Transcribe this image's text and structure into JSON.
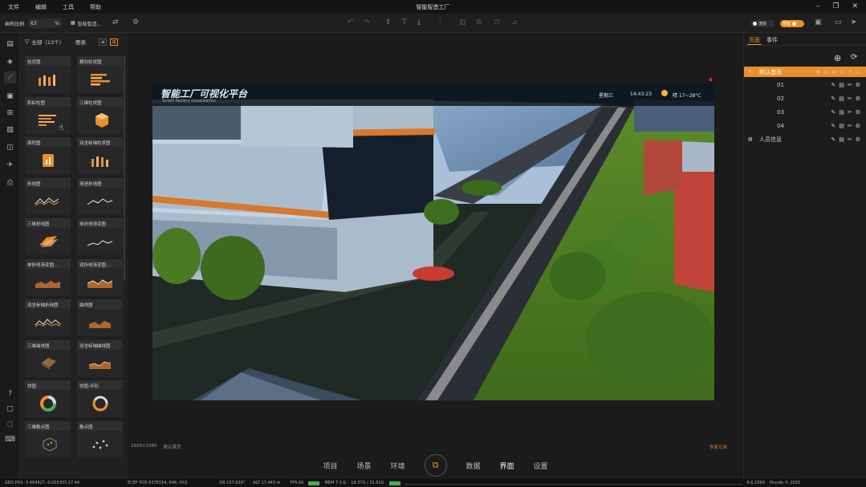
{
  "menu": {
    "items": [
      "文件",
      "编辑",
      "工具",
      "帮助"
    ],
    "title": "智能智造工厂"
  },
  "toolbar": {
    "label": "画布比例",
    "zoom_value": "63",
    "zoom_unit": "%",
    "smart_label": "智能智造...",
    "toggle_left": "渲染",
    "toggle_right": "预览"
  },
  "sidebar_icons": [
    "page-icon",
    "layer-icon",
    "chart-icon",
    "media-icon",
    "table-icon",
    "image-icon",
    "data-icon",
    "plane-icon",
    "printer-icon",
    "help-icon",
    "info-icon",
    "chat-icon",
    "keyboard-icon"
  ],
  "gallery": {
    "filter_label": "全部（13个）",
    "category_label": "图表",
    "cards": [
      {
        "label": "柱状图",
        "thumb": "bars"
      },
      {
        "label": "横向柱状图",
        "thumb": "hbars"
      },
      {
        "label": "彩虹柱图",
        "thumb": "hbars2"
      },
      {
        "label": "三维柱状图",
        "thumb": "cube"
      },
      {
        "label": "面积图",
        "thumb": "square"
      },
      {
        "label": "双坐标轴柱状图",
        "thumb": "bars2"
      },
      {
        "label": "折线图",
        "thumb": "line"
      },
      {
        "label": "渐进折线图",
        "thumb": "line2"
      },
      {
        "label": "三维折线图",
        "thumb": "ribbon"
      },
      {
        "label": "单折线渐变图",
        "thumb": "line3"
      },
      {
        "label": "单折线渐变图...",
        "thumb": "area"
      },
      {
        "label": "双折线渐变图...",
        "thumb": "area2"
      },
      {
        "label": "双坐标轴折线图",
        "thumb": "line4"
      },
      {
        "label": "曲线图",
        "thumb": "area3"
      },
      {
        "label": "三维曲线图",
        "thumb": "cube2"
      },
      {
        "label": "双坐标轴曲线图",
        "thumb": "area4"
      },
      {
        "label": "饼图",
        "thumb": "donut"
      },
      {
        "label": "饼图-环形",
        "thumb": "ring"
      },
      {
        "label": "三维散点图",
        "thumb": "cube3"
      },
      {
        "label": "散点图",
        "thumb": "scatter"
      }
    ]
  },
  "scene": {
    "title": "智能工厂可视化平台",
    "subtitle": "Smart factory visualization",
    "weekday": "星期三",
    "time": "14:43:23",
    "weather": "晴 17~28°C"
  },
  "canvas_status": {
    "resolution": "1920×1080",
    "page": "默认首页",
    "right": "恢复记录"
  },
  "bottom_nav": [
    "项目",
    "场景",
    "环境",
    "",
    "数据",
    "界面",
    "设置"
  ],
  "right_panel": {
    "tabs": [
      "页面",
      "事件"
    ],
    "rows": [
      {
        "label": "默认首页",
        "level": 0,
        "active": true
      },
      {
        "label": "01",
        "level": 1
      },
      {
        "label": "02",
        "level": 1
      },
      {
        "label": "03",
        "level": 1
      },
      {
        "label": "04",
        "level": 1
      },
      {
        "label": "人员信息",
        "level": 0
      }
    ]
  },
  "statusbar": [
    "GEO POS  -3.494927,-0.005307,17.44",
    "ECEF POS  6378154,-546,-553",
    "DR  157.939°",
    "ALT  17.443 m",
    "FPS  60",
    "MEM  7.3 G",
    "18.37G / 31.91G",
    "6.6.2369",
    "Piccolo © 2025"
  ]
}
